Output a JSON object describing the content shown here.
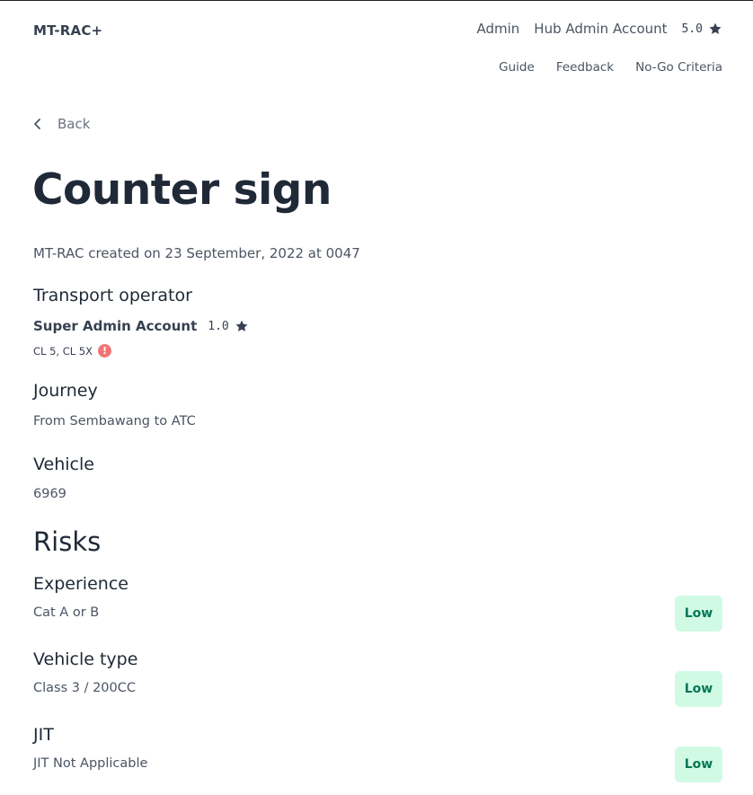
{
  "header": {
    "brand": "MT-RAC+",
    "role": "Admin",
    "account_name": "Hub Admin Account",
    "account_rating": "5.0",
    "subnav": [
      "Guide",
      "Feedback",
      "No-Go Criteria"
    ]
  },
  "back_label": "Back",
  "page_title": "Counter sign",
  "created_text": "MT-RAC created on 23 September, 2022 at 0047",
  "transport_operator": {
    "heading": "Transport operator",
    "name": "Super Admin Account",
    "rating": "1.0",
    "licences": "CL 5, CL 5X",
    "warning_glyph": "!"
  },
  "journey": {
    "heading": "Journey",
    "value": "From Sembawang to ATC"
  },
  "vehicle": {
    "heading": "Vehicle",
    "value": "6969"
  },
  "risks": {
    "heading": "Risks",
    "items": [
      {
        "title": "Experience",
        "value": "Cat A or B",
        "level": "Low"
      },
      {
        "title": "Vehicle type",
        "value": "Class 3 / 200CC",
        "level": "Low"
      },
      {
        "title": "JIT",
        "value": "JIT Not Applicable",
        "level": "Low"
      }
    ]
  },
  "colors": {
    "low_badge_bg": "#d1fae5",
    "low_badge_text": "#047857",
    "warning": "#f07676"
  }
}
